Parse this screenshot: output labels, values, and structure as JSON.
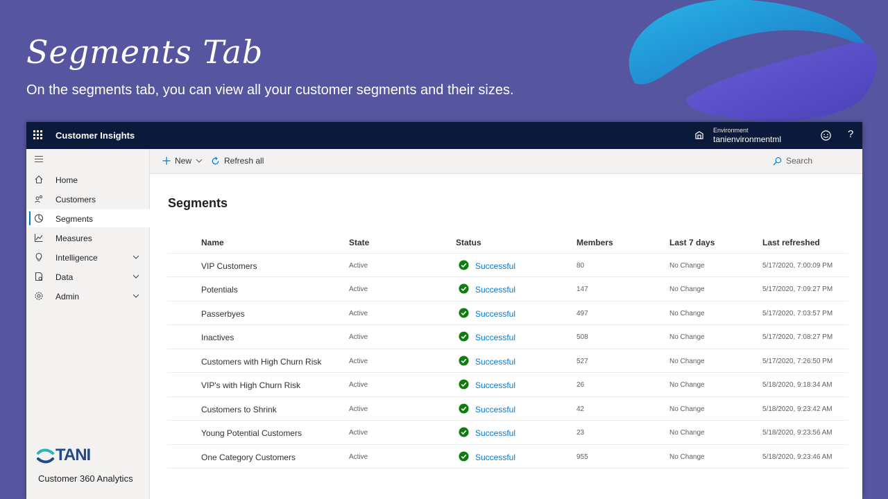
{
  "slide": {
    "title": "Segments Tab",
    "subtitle": "On the segments tab, you can view all your customer segments and their sizes."
  },
  "topbar": {
    "app_name": "Customer Insights",
    "environment_label": "Environment",
    "environment_name": "tanienvironmentml",
    "help": "?"
  },
  "sidebar": {
    "items": [
      {
        "label": "Home",
        "icon": "home-icon"
      },
      {
        "label": "Customers",
        "icon": "people-icon"
      },
      {
        "label": "Segments",
        "icon": "pie-icon",
        "active": true
      },
      {
        "label": "Measures",
        "icon": "chart-icon"
      },
      {
        "label": "Intelligence",
        "icon": "lightbulb-icon",
        "expandable": true
      },
      {
        "label": "Data",
        "icon": "database-icon",
        "expandable": true
      },
      {
        "label": "Admin",
        "icon": "gear-icon",
        "expandable": true
      }
    ],
    "brand_name": "TANI",
    "brand_tagline": "Customer 360 Analytics"
  },
  "commandbar": {
    "new_label": "New",
    "refresh_label": "Refresh all",
    "search_placeholder": "Search"
  },
  "main": {
    "title": "Segments",
    "columns": [
      "Name",
      "State",
      "Status",
      "Members",
      "Last 7 days",
      "Last refreshed"
    ],
    "rows": [
      {
        "name": "VIP Customers",
        "state": "Active",
        "status": "Successful",
        "members": "80",
        "last7": "No Change",
        "refreshed": "5/17/2020, 7:00:09 PM"
      },
      {
        "name": "Potentials",
        "state": "Active",
        "status": "Successful",
        "members": "147",
        "last7": "No Change",
        "refreshed": "5/17/2020, 7:09:27 PM"
      },
      {
        "name": "Passerbyes",
        "state": "Active",
        "status": "Successful",
        "members": "497",
        "last7": "No Change",
        "refreshed": "5/17/2020, 7:03:57 PM"
      },
      {
        "name": "Inactives",
        "state": "Active",
        "status": "Successful",
        "members": "508",
        "last7": "No Change",
        "refreshed": "5/17/2020, 7:08:27 PM"
      },
      {
        "name": "Customers with High Churn Risk",
        "state": "Active",
        "status": "Successful",
        "members": "527",
        "last7": "No Change",
        "refreshed": "5/17/2020, 7:26:50 PM"
      },
      {
        "name": "VIP's with High Churn Risk",
        "state": "Active",
        "status": "Successful",
        "members": "26",
        "last7": "No Change",
        "refreshed": "5/18/2020, 9:18:34 AM"
      },
      {
        "name": "Customers to Shrink",
        "state": "Active",
        "status": "Successful",
        "members": "42",
        "last7": "No Change",
        "refreshed": "5/18/2020, 9:23:42 AM"
      },
      {
        "name": "Young Potential Customers",
        "state": "Active",
        "status": "Successful",
        "members": "23",
        "last7": "No Change",
        "refreshed": "5/18/2020, 9:23:56 AM"
      },
      {
        "name": "One Category Customers",
        "state": "Active",
        "status": "Successful",
        "members": "955",
        "last7": "No Change",
        "refreshed": "5/18/2020, 9:23:46 AM"
      }
    ]
  },
  "colors": {
    "background": "#5555a0",
    "topbar": "#0b1a3a",
    "accent": "#0078d4",
    "success": "#107c10"
  }
}
